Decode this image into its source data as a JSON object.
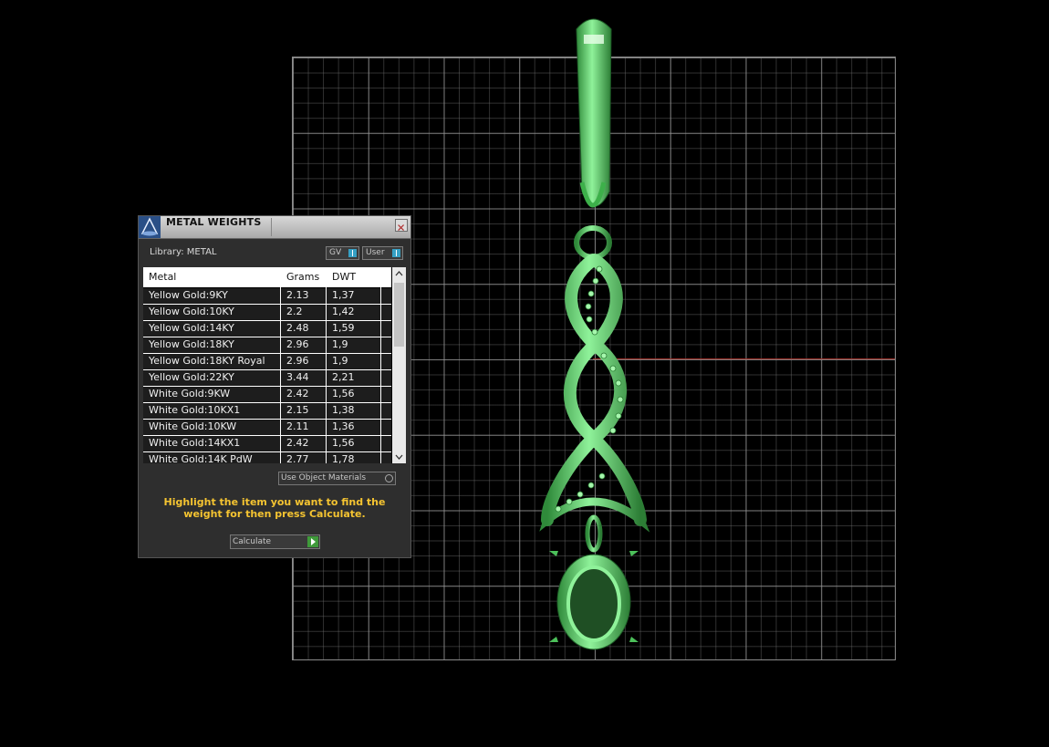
{
  "panel": {
    "title": "METAL WEIGHTS",
    "library_label": "Library: METAL",
    "toggles": {
      "gv": "GV",
      "user": "User"
    },
    "table": {
      "headers": [
        "Metal",
        "Grams",
        "DWT"
      ],
      "rows": [
        {
          "metal": "Yellow Gold:9KY",
          "grams": "2.13",
          "dwt": "1,37"
        },
        {
          "metal": "Yellow Gold:10KY",
          "grams": "2.2",
          "dwt": "1,42"
        },
        {
          "metal": "Yellow Gold:14KY",
          "grams": "2.48",
          "dwt": "1,59"
        },
        {
          "metal": "Yellow Gold:18KY",
          "grams": "2.96",
          "dwt": "1,9"
        },
        {
          "metal": "Yellow Gold:18KY Royal",
          "grams": "2.96",
          "dwt": "1,9"
        },
        {
          "metal": "Yellow Gold:22KY",
          "grams": "3.44",
          "dwt": "2,21"
        },
        {
          "metal": "White Gold:9KW",
          "grams": "2.42",
          "dwt": "1,56"
        },
        {
          "metal": "White Gold:10KX1",
          "grams": "2.15",
          "dwt": "1,38"
        },
        {
          "metal": "White Gold:10KW",
          "grams": "2.11",
          "dwt": "1,36"
        },
        {
          "metal": "White Gold:14KX1",
          "grams": "2.42",
          "dwt": "1,56"
        },
        {
          "metal": "White Gold:14K PdW",
          "grams": "2.77",
          "dwt": "1,78"
        }
      ]
    },
    "use_object_materials": "Use Object Materials",
    "instruction": "Highlight the item you want to find the weight for then press Calculate.",
    "calculate_label": "Calculate"
  },
  "colors": {
    "model_green": "#6fe07a",
    "instruction_yellow": "#f5c431",
    "axis_red": "#a0302a"
  }
}
